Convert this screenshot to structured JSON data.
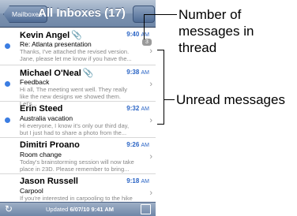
{
  "nav": {
    "back_label": "Mailboxes",
    "title": "All Inboxes (17)"
  },
  "messages": [
    {
      "sender": "Kevin Angel",
      "time": "9:40",
      "ampm": "AM",
      "subject": "Re: Atlanta presentation",
      "preview": "Thanks, I've attached the revised version. Jane, please let me know if you have the...",
      "unread": true,
      "attachment": true,
      "count": "3"
    },
    {
      "sender": "Michael O'Neal",
      "time": "9:38",
      "ampm": "AM",
      "subject": "Feedback",
      "preview": "Hi all, The meeting went well. They really like the new designs we showed them. Let's...",
      "unread": true,
      "attachment": true
    },
    {
      "sender": "Erin Steed",
      "time": "9:32",
      "ampm": "AM",
      "subject": "Australia vacation",
      "preview": "Hi everyone, I know it's only our third day, but I just had to share a photo from the...",
      "unread": true,
      "attachment": false
    },
    {
      "sender": "Dimitri Proano",
      "time": "9:26",
      "ampm": "AM",
      "subject": "Room change",
      "preview": "Today's brainstorming session will now take place in 23D. Please remember to bring...",
      "unread": false,
      "attachment": false
    },
    {
      "sender": "Jason Russell",
      "time": "9:18",
      "ampm": "AM",
      "subject": "Carpool",
      "preview": "If you're interested in carpooling to the hike this weekend, please let me know by...",
      "unread": false,
      "attachment": false
    }
  ],
  "toolbar": {
    "updated_label": "Updated",
    "updated_value": "6/07/10 9:41 AM"
  },
  "callouts": {
    "thread_count": "Number of messages in thread",
    "unread": "Unread messages"
  },
  "colors": {
    "unread_dot": "#3b7de2",
    "time_text": "#2a64c5",
    "navbar": "#7d93b0"
  },
  "icons": {
    "refresh": "refresh-icon",
    "compose": "compose-icon",
    "attachment": "paperclip-icon",
    "chevron": "chevron-right-icon"
  }
}
